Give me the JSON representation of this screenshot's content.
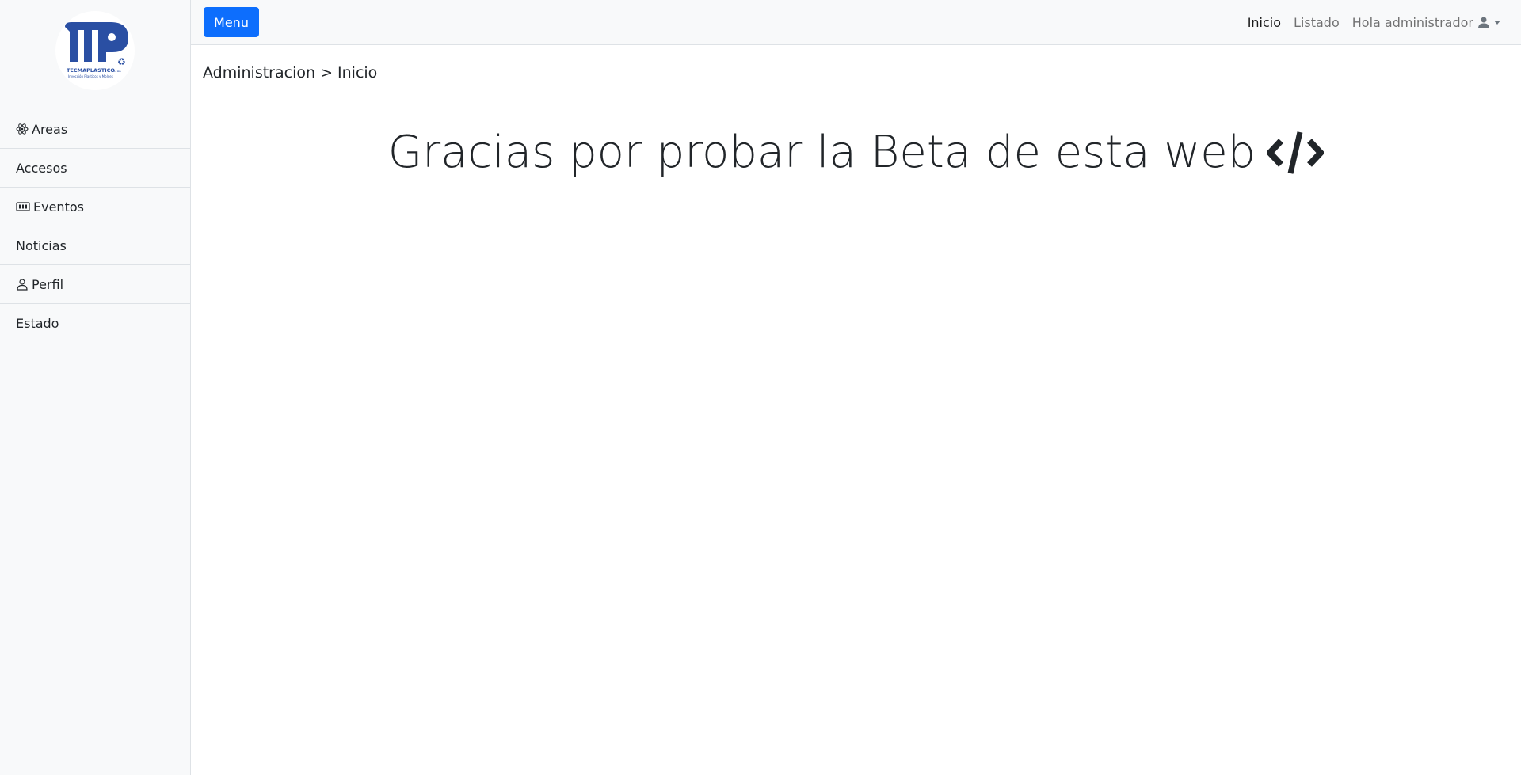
{
  "sidebar": {
    "logo": {
      "name": "TECMAPLASTICO",
      "suffix": "LTDA",
      "tagline": "Inyección Plasticos y Moldes"
    },
    "items": [
      {
        "label": "Areas",
        "icon": "atom-icon"
      },
      {
        "label": "Accesos",
        "icon": ""
      },
      {
        "label": "Eventos",
        "icon": "ticket-icon"
      },
      {
        "label": "Noticias",
        "icon": ""
      },
      {
        "label": "Perfil",
        "icon": "person-icon"
      },
      {
        "label": "Estado",
        "icon": ""
      }
    ]
  },
  "topbar": {
    "menu_label": "Menu",
    "nav": {
      "inicio": "Inicio",
      "listado": "Listado",
      "user": "Hola administrador"
    }
  },
  "main": {
    "breadcrumb": "Administracion > Inicio",
    "headline": "Gracias por probar la Beta de esta web"
  },
  "colors": {
    "accent": "#0d6efd",
    "logo_blue": "#2a4fa3",
    "sidebar_bg": "#f8f9fa"
  }
}
